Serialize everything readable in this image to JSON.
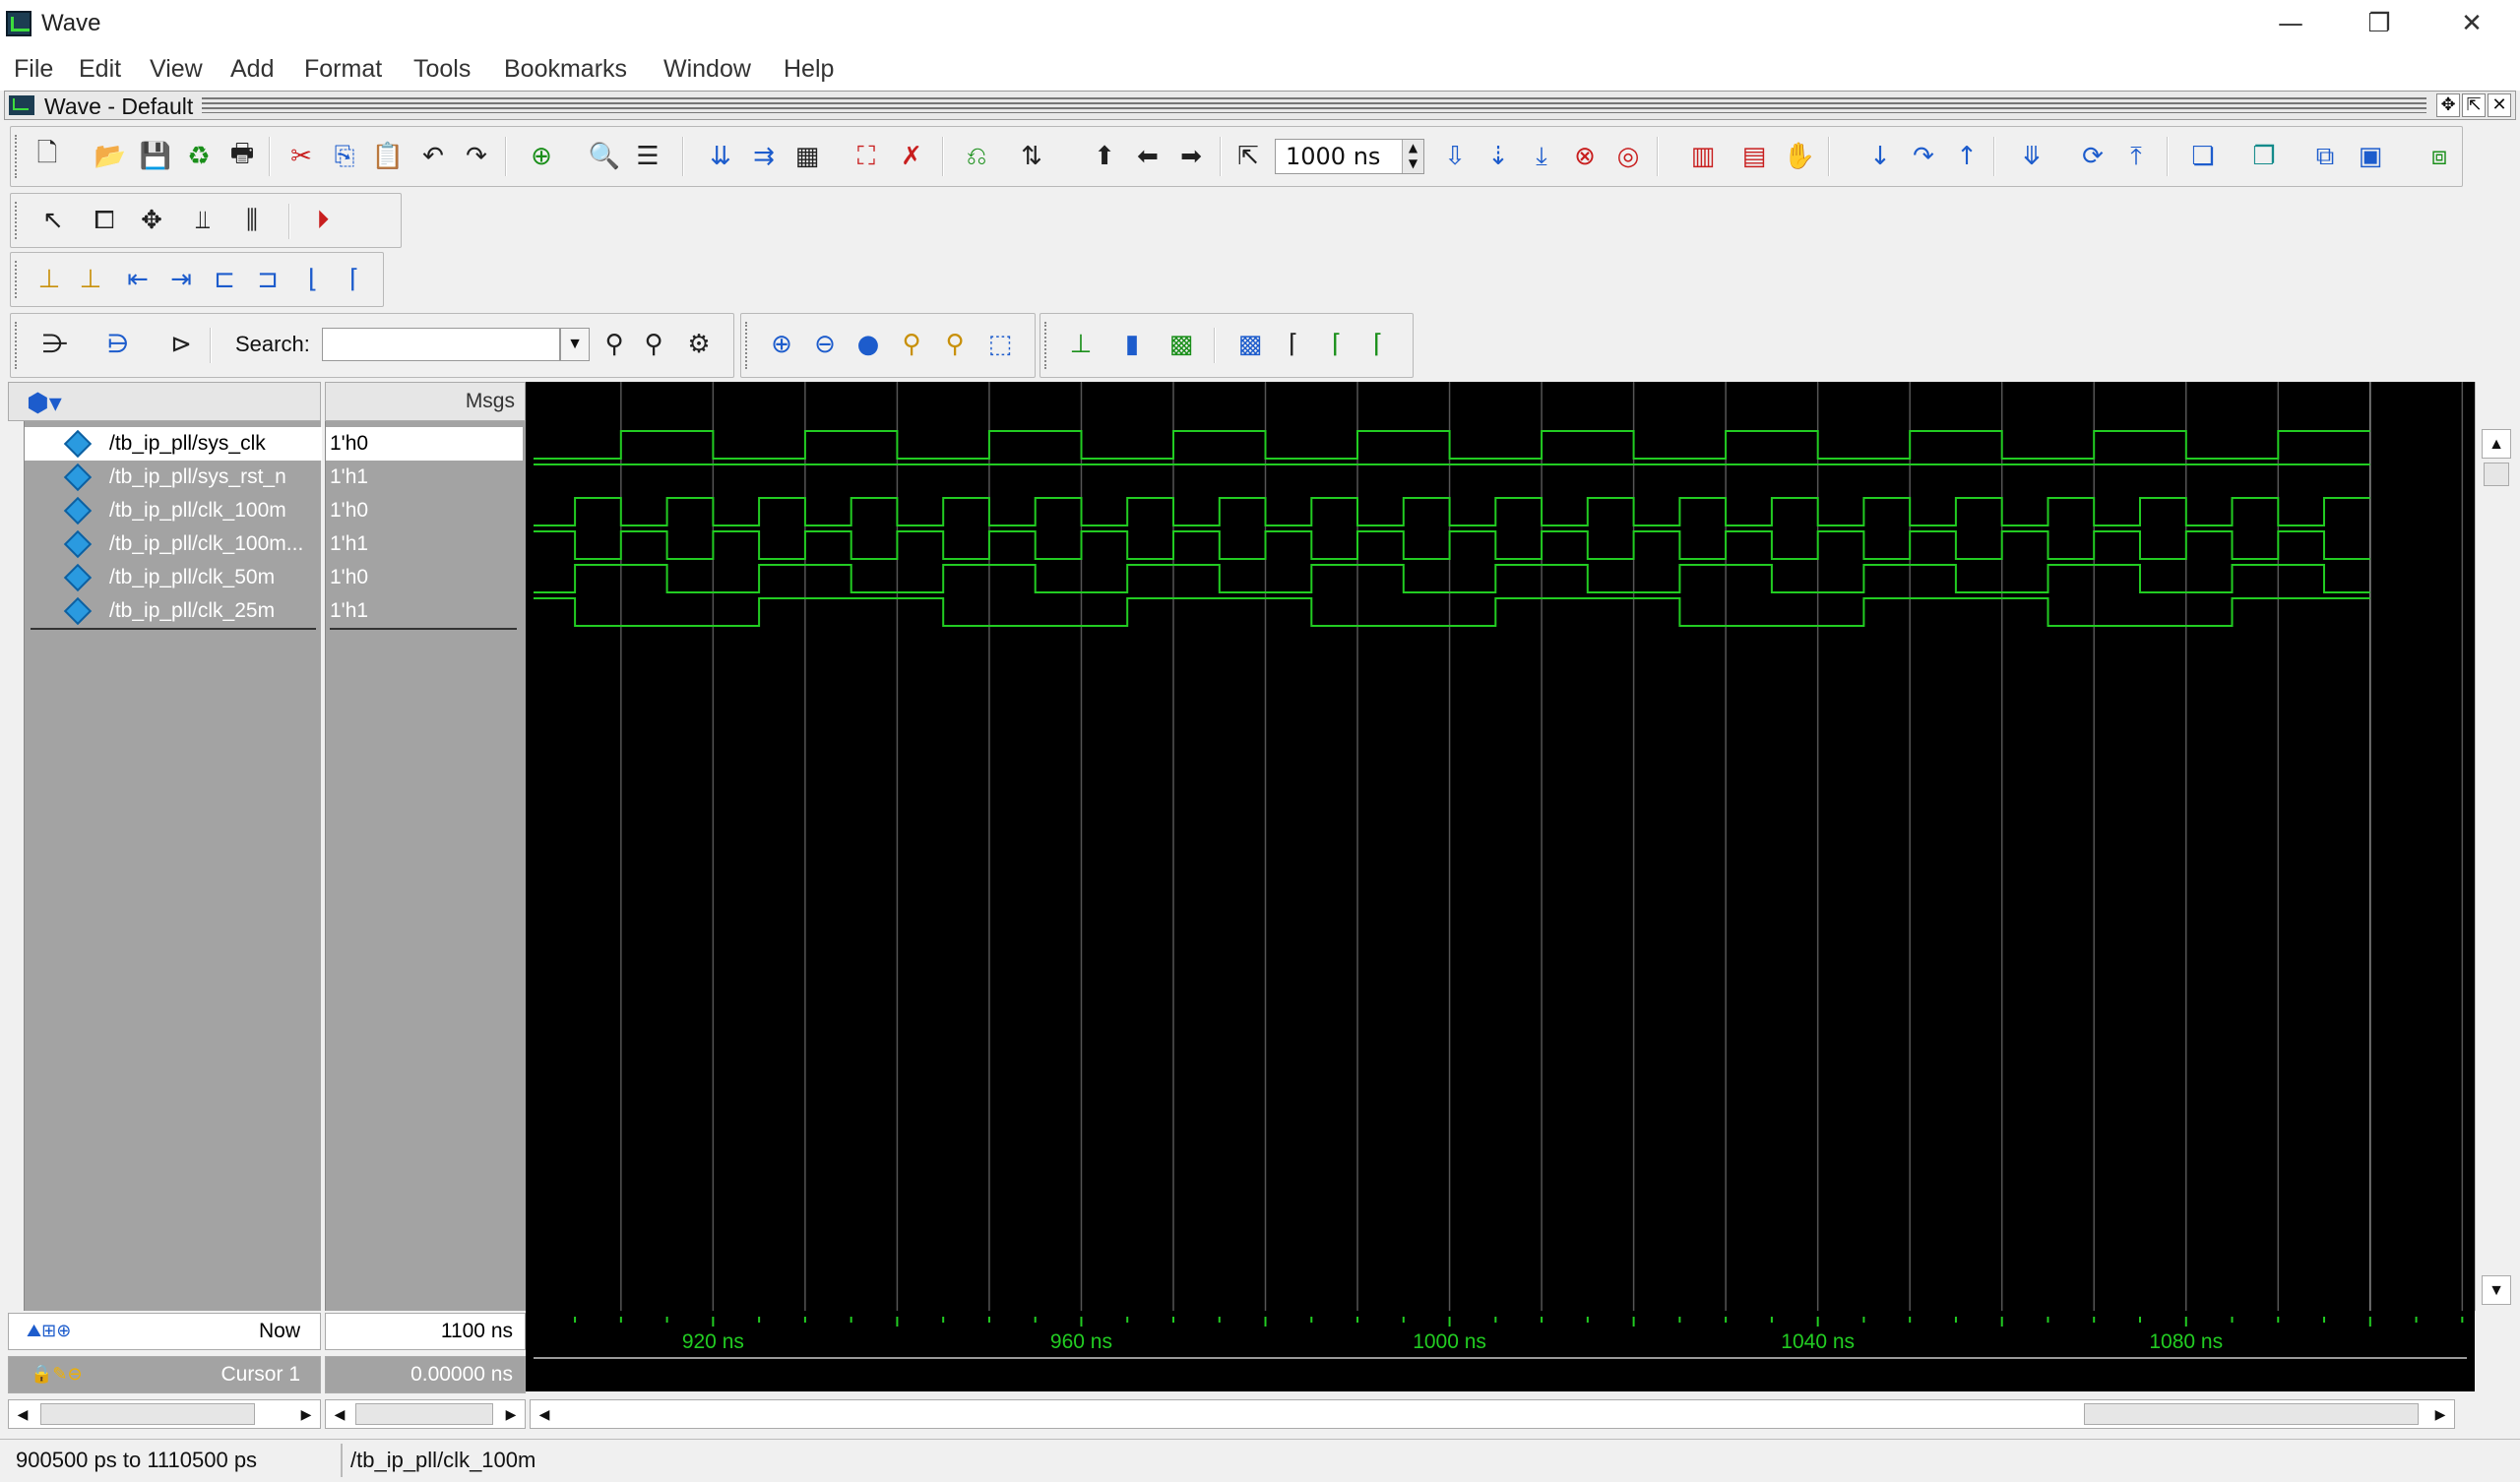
{
  "window": {
    "title": "Wave",
    "minimize_glyph": "—",
    "maximize_glyph": "❐",
    "close_glyph": "✕"
  },
  "menu": [
    "File",
    "Edit",
    "View",
    "Add",
    "Format",
    "Tools",
    "Bookmarks",
    "Window",
    "Help"
  ],
  "subwindow": {
    "title": "Wave - Default"
  },
  "toolbar": {
    "run_length": "1000 ns",
    "search_label": "Search:",
    "search_value": ""
  },
  "header": {
    "msgs_label": "Msgs"
  },
  "signals": [
    {
      "name": "/tb_ip_pll/sys_clk",
      "value": "1'h0",
      "selected": true
    },
    {
      "name": "/tb_ip_pll/sys_rst_n",
      "value": "1'h1",
      "selected": false
    },
    {
      "name": "/tb_ip_pll/clk_100m",
      "value": "1'h0",
      "selected": false
    },
    {
      "name": "/tb_ip_pll/clk_100m...",
      "value": "1'h1",
      "selected": false
    },
    {
      "name": "/tb_ip_pll/clk_50m",
      "value": "1'h0",
      "selected": false
    },
    {
      "name": "/tb_ip_pll/clk_25m",
      "value": "1'h1",
      "selected": false
    }
  ],
  "footer": {
    "now_label": "Now",
    "now_value": "1100 ns",
    "cursor_label": "Cursor 1",
    "cursor_value": "0.00000 ns"
  },
  "timeline": {
    "labels": [
      "920 ns",
      "960 ns",
      "1000 ns",
      "1040 ns",
      "1080 ns"
    ],
    "label_times_ns": [
      920,
      960,
      1000,
      1040,
      1080
    ]
  },
  "waveform": {
    "view_start_ns": 900.5,
    "view_end_ns": 1110.5,
    "trace_end_ns": 1100,
    "sys_clk_period_ns": 20,
    "clk_100m_period_ns": 10,
    "clk_50m_period_ns": 20,
    "clk_25m_period_ns": 40,
    "trace_color": "#22cc22",
    "grid_color": "#555555"
  },
  "status": {
    "range": "900500 ps to 1110500 ps",
    "selected_signal": "/tb_ip_pll/clk_100m"
  }
}
